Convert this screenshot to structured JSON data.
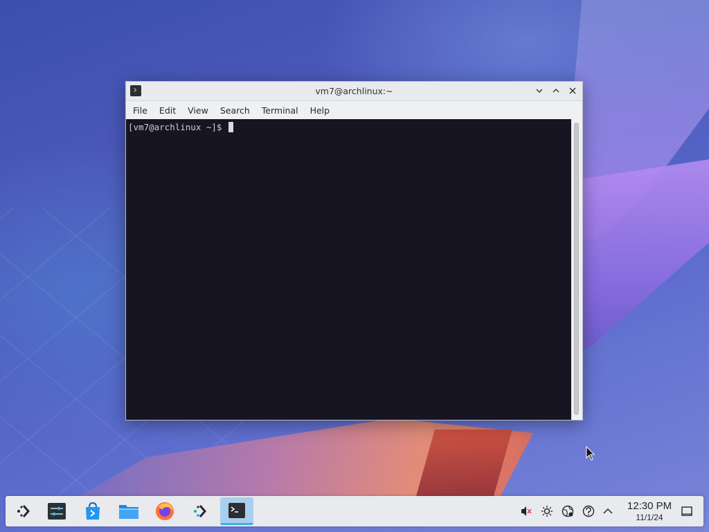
{
  "window": {
    "title": "vm7@archlinux:~",
    "menu": [
      "File",
      "Edit",
      "View",
      "Search",
      "Terminal",
      "Help"
    ],
    "prompt": "[vm7@archlinux ~]$"
  },
  "taskbar": {
    "apps": [
      {
        "name": "application-launcher-icon"
      },
      {
        "name": "system-settings-icon"
      },
      {
        "name": "discover-store-icon"
      },
      {
        "name": "file-manager-icon"
      },
      {
        "name": "firefox-icon"
      },
      {
        "name": "kde-connect-icon"
      },
      {
        "name": "terminal-icon",
        "active": true
      }
    ],
    "clock": {
      "time": "12:30 PM",
      "date": "11/1/24"
    }
  },
  "colors": {
    "terminal_bg": "#171521",
    "accent": "#3daee9",
    "taskbar_bg": "#e8eaed"
  }
}
